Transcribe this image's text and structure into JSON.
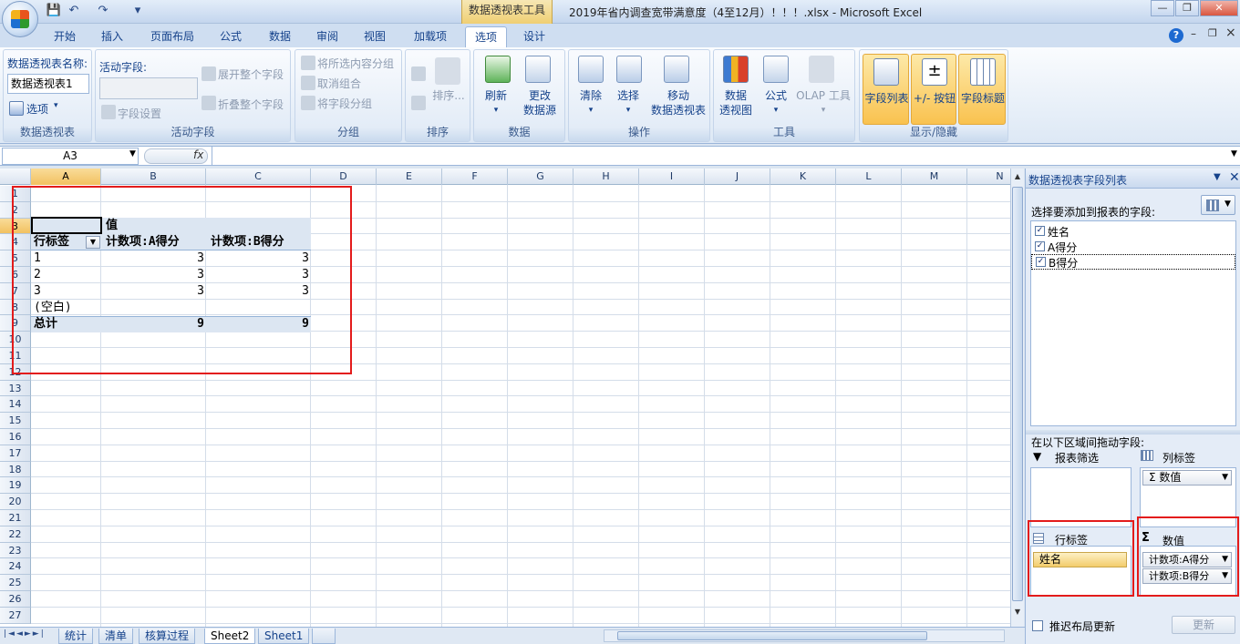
{
  "window": {
    "context_tool": "数据透视表工具",
    "title": "2019年省内调查宽带满意度（4至12月）！！！.xlsx - Microsoft Excel",
    "qat": {
      "save": "💾",
      "undo": "↶",
      "redo": "↷",
      "more": "▾"
    },
    "controls": {
      "min": "—",
      "restore": "❐",
      "close": "✕"
    },
    "help": "?",
    "sub_controls": {
      "min": "–",
      "restore": "❐",
      "close": "×"
    }
  },
  "tabs": [
    "开始",
    "插入",
    "页面布局",
    "公式",
    "数据",
    "审阅",
    "视图",
    "加载项",
    "选项",
    "设计"
  ],
  "active_tab": "选项",
  "ribbon": {
    "pivot": {
      "name_label": "数据透视表名称:",
      "name_value": "数据透视表1",
      "options": "选项",
      "group": "数据透视表"
    },
    "active_field": {
      "label": "活动字段:",
      "field_settings": "字段设置",
      "expand": "展开整个字段",
      "collapse": "折叠整个字段",
      "group": "活动字段"
    },
    "grouping": {
      "group_selection": "将所选内容分组",
      "ungroup": "取消组合",
      "group_field": "将字段分组",
      "group": "分组"
    },
    "sort": {
      "sort": "排序...",
      "group": "排序"
    },
    "data": {
      "refresh": "刷新",
      "change_source_1": "更改",
      "change_source_2": "数据源",
      "group": "数据"
    },
    "actions": {
      "clear": "清除",
      "select": "选择",
      "move_1": "移动",
      "move_2": "数据透视表",
      "group": "操作"
    },
    "tools": {
      "pivotchart_1": "数据",
      "pivotchart_2": "透视图",
      "formula": "公式",
      "olap": "OLAP 工具",
      "group": "工具"
    },
    "show_hide": {
      "field_list": "字段列表",
      "buttons": "+/- 按钮",
      "headers": "字段标题",
      "group": "显示/隐藏"
    }
  },
  "formula_bar": {
    "name_box": "A3",
    "fx": "fx",
    "formula": ""
  },
  "sheet": {
    "columns": [
      "A",
      "B",
      "C",
      "D",
      "E",
      "F",
      "G",
      "H",
      "I",
      "J",
      "K",
      "L",
      "M",
      "N"
    ],
    "rows": [
      "1",
      "2",
      "3",
      "4",
      "5",
      "6",
      "7",
      "8",
      "9",
      "10",
      "11",
      "12",
      "13",
      "14",
      "15",
      "16",
      "17",
      "18",
      "19",
      "20",
      "21",
      "22",
      "23",
      "24",
      "25",
      "26",
      "27"
    ],
    "pivot": {
      "values_header": "值",
      "row_label": "行标签",
      "col_b": "计数项:A得分",
      "col_c": "计数项:B得分",
      "data_rows": [
        {
          "label": "1",
          "b": "3",
          "c": "3"
        },
        {
          "label": "2",
          "b": "3",
          "c": "3"
        },
        {
          "label": "3",
          "b": "3",
          "c": "3"
        },
        {
          "label": "(空白)",
          "b": "",
          "c": ""
        }
      ],
      "total": {
        "label": "总计",
        "b": "9",
        "c": "9"
      }
    }
  },
  "sheet_tabs": [
    "统计",
    "清单",
    "核算过程",
    "Sheet2",
    "Sheet1"
  ],
  "active_sheet": "Sheet2",
  "pane": {
    "title": "数据透视表字段列表",
    "choose_label": "选择要添加到报表的字段:",
    "fields": [
      {
        "name": "姓名",
        "checked": true
      },
      {
        "name": "A得分",
        "checked": true
      },
      {
        "name": "B得分",
        "checked": true
      }
    ],
    "drag_label": "在以下区域间拖动字段:",
    "report_filter": "报表筛选",
    "column_labels": "列标签",
    "column_chip": "Σ 数值",
    "row_labels": "行标签",
    "values": "数值",
    "row_chip": "姓名",
    "value_chips": [
      "计数项:A得分",
      "计数项:B得分"
    ],
    "defer_update": "推迟布局更新",
    "update_btn": "更新"
  }
}
